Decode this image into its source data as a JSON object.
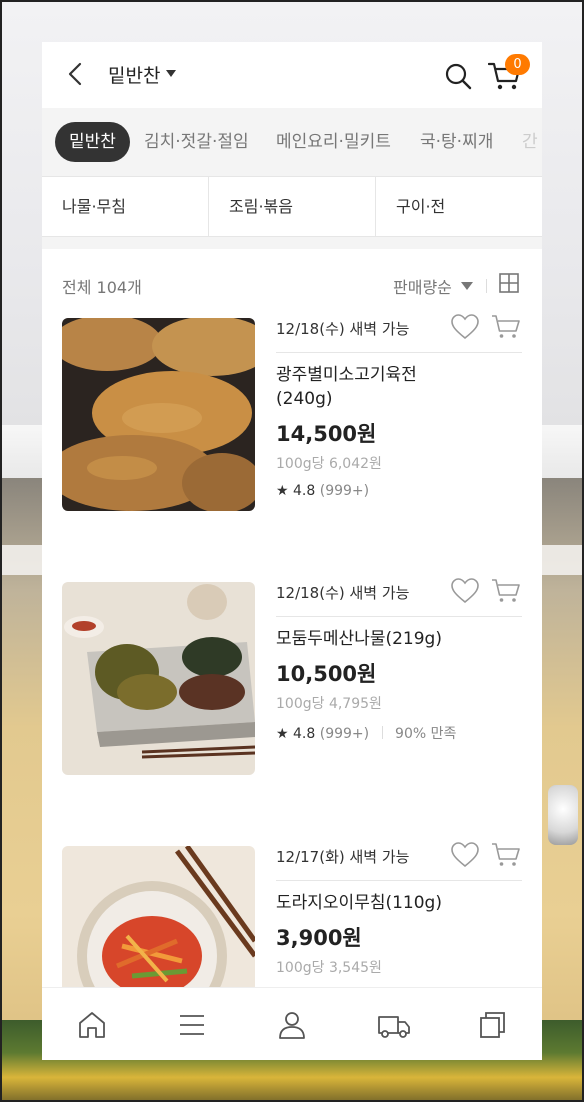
{
  "header": {
    "title": "밑반찬",
    "cart_count": "0"
  },
  "category_tabs": [
    {
      "label": "밑반찬",
      "active": true
    },
    {
      "label": "김치·젓갈·절임",
      "active": false
    },
    {
      "label": "메인요리·밀키트",
      "active": false
    },
    {
      "label": "국·탕·찌개",
      "active": false
    },
    {
      "label": "간",
      "active": false
    }
  ],
  "sub_categories": [
    "나물·무침",
    "조림·볶음",
    "구이·전"
  ],
  "list": {
    "total": "전체 104개",
    "sort": "판매량순"
  },
  "products": [
    {
      "delivery": "12/18(수) 새벽 가능",
      "name": "광주별미소고기육전\n(240g)",
      "price": "14,500원",
      "unit_price": "100g당 6,042원",
      "rating": "4.8",
      "reviews": "(999+)",
      "satisfaction": ""
    },
    {
      "delivery": "12/18(수) 새벽 가능",
      "name": "모둠두메산나물(219g)",
      "price": "10,500원",
      "unit_price": "100g당 4,795원",
      "rating": "4.8",
      "reviews": "(999+)",
      "satisfaction": "90% 만족"
    },
    {
      "delivery": "12/17(화) 새벽 가능",
      "name": "도라지오이무침(110g)",
      "price": "3,900원",
      "unit_price": "100g당 3,545원",
      "rating": "",
      "reviews": "",
      "satisfaction": ""
    }
  ],
  "bottom_nav": [
    "home-icon",
    "menu-icon",
    "user-icon",
    "truck-icon",
    "recent-icon"
  ],
  "colors": {
    "accent": "#ff7a00",
    "active_tab": "#333333"
  }
}
